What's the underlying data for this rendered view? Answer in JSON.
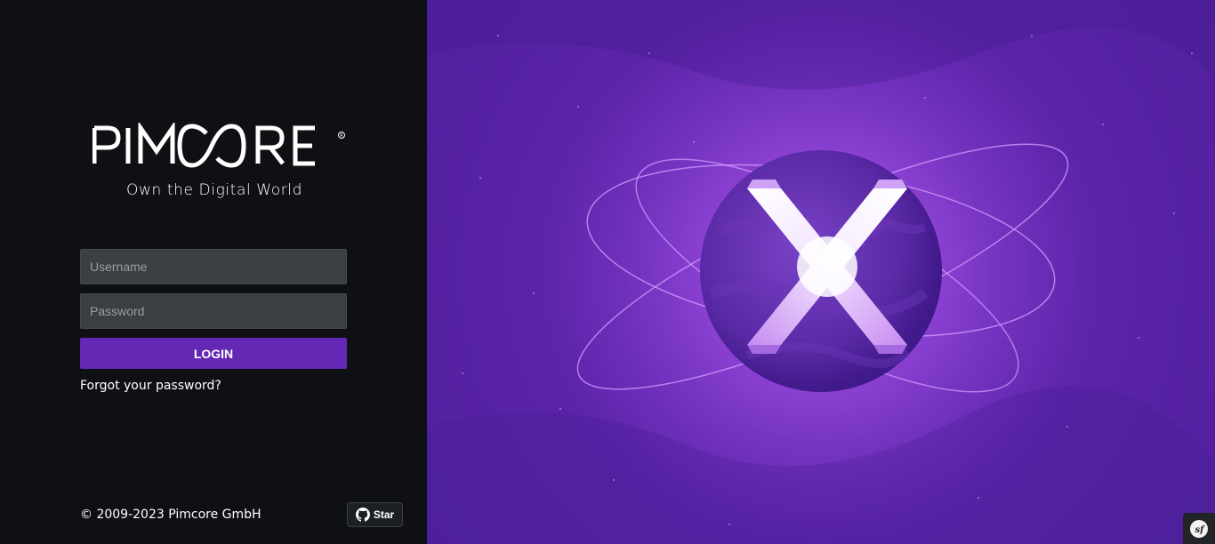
{
  "brand": {
    "logo_text": "PIMCORE",
    "tagline": "Own the Digital World"
  },
  "form": {
    "username_placeholder": "Username",
    "username_value": "",
    "password_placeholder": "Password",
    "password_value": "",
    "login_label": "LOGIN",
    "forgot_label": "Forgot your password?"
  },
  "footer": {
    "copyright": "© 2009-2023 Pimcore GmbH",
    "star_label": "Star",
    "star_icon": "github-icon"
  },
  "hero": {
    "icon": "pimcore-x-planet-icon"
  },
  "debug": {
    "icon": "symfony-icon"
  },
  "colors": {
    "accent": "#6428b4",
    "left_bg": "#0e1013",
    "input_bg": "#3b3e42",
    "hero_bg": "#5a24a8"
  }
}
